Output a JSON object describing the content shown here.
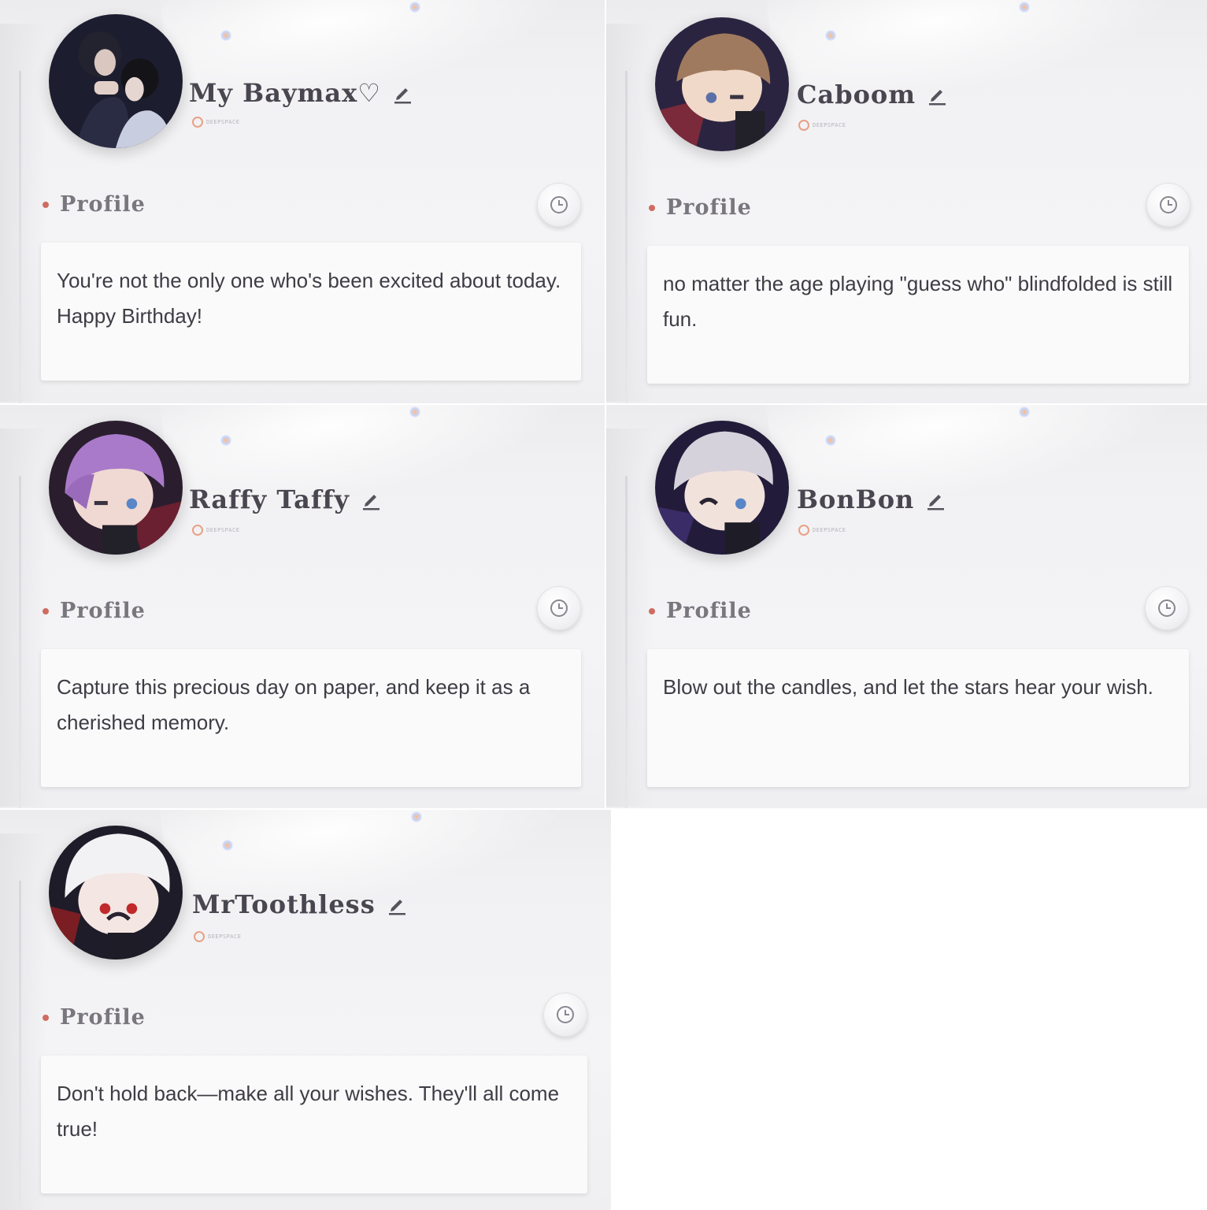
{
  "cards": [
    {
      "name": "My Baymax♡",
      "sub_label": "DEEPSPACE",
      "profile_label": "Profile",
      "message": "You're not the only one who's been excited about today. Happy Birthday!",
      "avatar": "couple-photo-avatar"
    },
    {
      "name": "Caboom",
      "sub_label": "DEEPSPACE",
      "profile_label": "Profile",
      "message": "no matter the age playing \"guess who\" blindfolded is still fun.",
      "avatar": "brown-hair-chibi-avatar"
    },
    {
      "name": "Raffy Taffy",
      "sub_label": "DEEPSPACE",
      "profile_label": "Profile",
      "message": "Capture this precious day on paper, and keep it as a cherished memory.",
      "avatar": "purple-hair-chibi-avatar"
    },
    {
      "name": "BonBon",
      "sub_label": "DEEPSPACE",
      "profile_label": "Profile",
      "message": "Blow out the candles, and let the stars hear your wish.",
      "avatar": "silver-hair-chibi-avatar"
    },
    {
      "name": "MrToothless",
      "sub_label": "DEEPSPACE",
      "profile_label": "Profile",
      "message": "Don't hold back—make all your wishes. They'll all come true!",
      "avatar": "white-hair-chibi-avatar"
    }
  ],
  "colors": {
    "accent_dot": "#d06b62",
    "name_text": "#4a4650",
    "message_text": "#3f3c44"
  },
  "icons": [
    "edit-pencil-icon",
    "history-clock-icon"
  ]
}
